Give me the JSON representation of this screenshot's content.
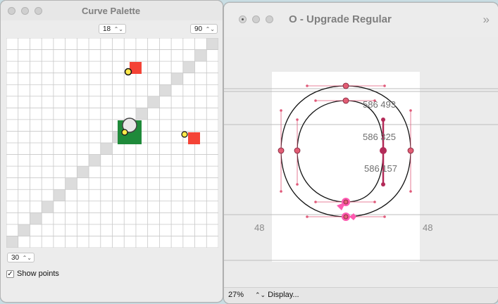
{
  "curve_palette": {
    "title": "Curve Palette",
    "top_left_value": "18",
    "top_right_value": "90",
    "bottom_value": "30",
    "show_points_label": "Show points",
    "show_points_checked": true,
    "colors": {
      "grid_line": "#c8c8c8",
      "diagonal": "#dcdcdc",
      "red": "#f44336",
      "green": "#1f8a3a",
      "yellow": "#ffe94a"
    }
  },
  "glyph_window": {
    "title": "O - Upgrade Regular",
    "expand_icon": "double-chevron-right-icon",
    "coords": [
      "586 493",
      "586 325",
      "586 157"
    ],
    "left_sidebearing": "48",
    "right_sidebearing": "48",
    "zoom": "27%",
    "display_menu_label": "Display..."
  }
}
